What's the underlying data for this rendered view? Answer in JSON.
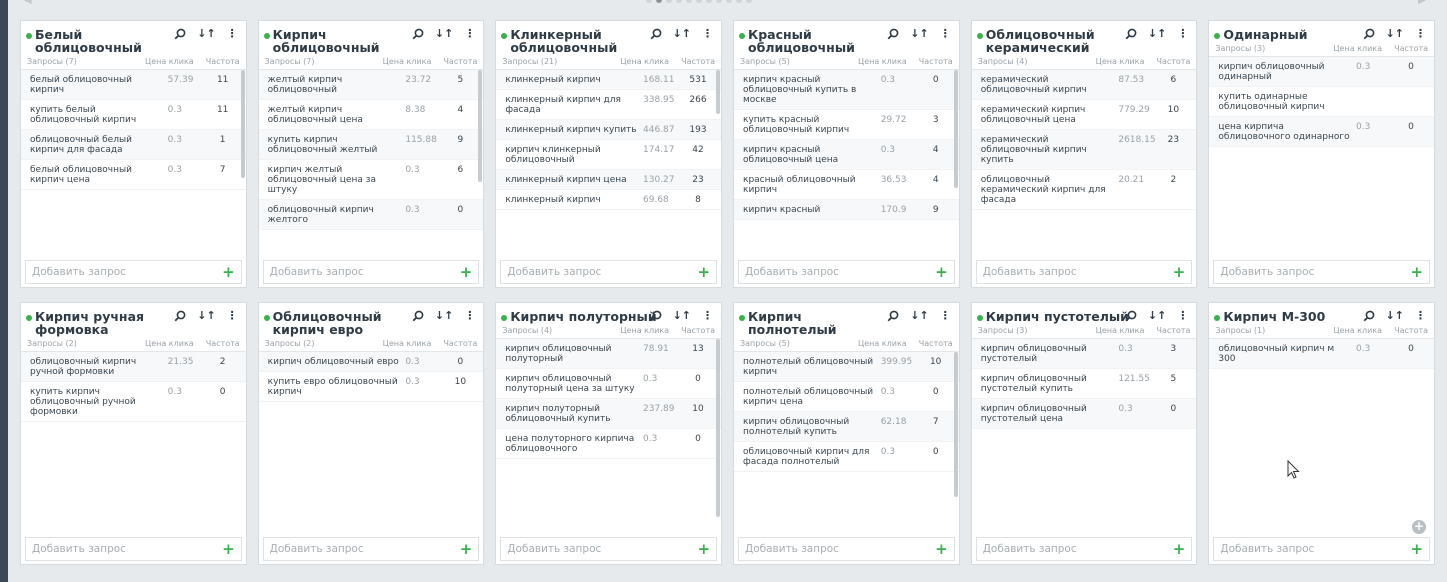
{
  "labels": {
    "col_price": "Цена клика",
    "col_freq": "Частота",
    "add_placeholder": "Добавить запрос"
  },
  "icons": {
    "search": "search-icon",
    "sort": "sort-icon",
    "more": "more-vertical-icon",
    "add": "plus-icon",
    "add_group": "circle-plus-icon",
    "cursor": "mouse-cursor-icon"
  },
  "colors": {
    "status": "#37b24d",
    "accent": "#37b24d"
  },
  "pager": {
    "total": 11,
    "active": 1
  },
  "cards": [
    {
      "title": "Белый облицовочный",
      "count": "Запросы (7)",
      "rows": [
        {
          "q": "белый облицовочный кирпич",
          "p": "57.39",
          "f": "11"
        },
        {
          "q": "купить белый облицовочный кирпич",
          "p": "0.3",
          "f": "11"
        },
        {
          "q": "облицовочный белый кирпич для фасада",
          "p": "0.3",
          "f": "1"
        },
        {
          "q": "белый облицовочный кирпич цена",
          "p": "0.3",
          "f": "7"
        }
      ]
    },
    {
      "title": "Кирпич облицовочный",
      "count": "Запросы (7)",
      "rows": [
        {
          "q": "желтый кирпич облицовочный",
          "p": "23.72",
          "f": "5"
        },
        {
          "q": "желтый кирпич облицовочный цена",
          "p": "8.38",
          "f": "4"
        },
        {
          "q": "купить кирпич облицовочный желтый",
          "p": "115.88",
          "f": "9"
        },
        {
          "q": "кирпич желтый облицовочный цена за штуку",
          "p": "0.3",
          "f": "6"
        },
        {
          "q": "облицовочный кирпич желтого",
          "p": "0.3",
          "f": "0"
        }
      ]
    },
    {
      "title": "Клинкерный облицовочный",
      "count": "Запросы (21)",
      "rows": [
        {
          "q": "клинкерный кирпич",
          "p": "168.11",
          "f": "531"
        },
        {
          "q": "клинкерный кирпич для фасада",
          "p": "338.95",
          "f": "266"
        },
        {
          "q": "клинкерный кирпич купить",
          "p": "446.87",
          "f": "193"
        },
        {
          "q": "кирпич клинкерный облицовочный",
          "p": "174.17",
          "f": "42"
        },
        {
          "q": "клинкерный кирпич цена",
          "p": "130.27",
          "f": "23"
        },
        {
          "q": "клинкерный кирпич",
          "p": "69.68",
          "f": "8"
        }
      ]
    },
    {
      "title": "Красный облицовочный",
      "count": "Запросы (5)",
      "rows": [
        {
          "q": "кирпич красный облицовочный купить в москве",
          "p": "0.3",
          "f": "0"
        },
        {
          "q": "купить красный облицовочный кирпич",
          "p": "29.72",
          "f": "3"
        },
        {
          "q": "кирпич красный облицовочный цена",
          "p": "0.3",
          "f": "4"
        },
        {
          "q": "красный облицовочный кирпич",
          "p": "36.53",
          "f": "4"
        },
        {
          "q": "кирпич красный",
          "p": "170.9",
          "f": "9"
        }
      ]
    },
    {
      "title": "Облицовочный керамический",
      "count": "Запросы (4)",
      "rows": [
        {
          "q": "керамический облицовочный кирпич",
          "p": "87.53",
          "f": "6"
        },
        {
          "q": "керамический кирпич облицовочный цена",
          "p": "779.29",
          "f": "10"
        },
        {
          "q": "керамический облицовочный кирпич купить",
          "p": "2618.15",
          "f": "23"
        },
        {
          "q": "облицовочный керамический кирпич для фасада",
          "p": "20.21",
          "f": "2"
        }
      ]
    },
    {
      "title": "Одинарный",
      "count": "Запросы (3)",
      "rows": [
        {
          "q": "кирпич облицовочный одинарный",
          "p": "0.3",
          "f": "0"
        },
        {
          "q": "купить одинарные облицовочный кирпич",
          "p": "",
          "f": ""
        },
        {
          "q": "цена кирпича облицовочного одинарного",
          "p": "0.3",
          "f": "0"
        }
      ]
    },
    {
      "title": "Кирпич ручная формовка",
      "count": "Запросы (2)",
      "rows": [
        {
          "q": "облицовочный кирпич ручной формовки",
          "p": "21.35",
          "f": "2"
        },
        {
          "q": "купить кирпич облицовочный ручной формовки",
          "p": "0.3",
          "f": "0"
        }
      ]
    },
    {
      "title": "Облицовочный кирпич евро",
      "count": "Запросы (2)",
      "rows": [
        {
          "q": "кирпич облицовочный евро",
          "p": "0.3",
          "f": "0"
        },
        {
          "q": "купить евро облицовочный кирпич",
          "p": "0.3",
          "f": "10"
        }
      ]
    },
    {
      "title": "Кирпич полуторный",
      "count": "Запросы (4)",
      "rows": [
        {
          "q": "кирпич облицовочный полуторный",
          "p": "78.91",
          "f": "13"
        },
        {
          "q": "кирпич облицовочный полуторный цена за штуку",
          "p": "0.3",
          "f": "0"
        },
        {
          "q": "кирпич полуторный облицовочный купить",
          "p": "237.89",
          "f": "10"
        },
        {
          "q": "цена полуторного кирпича облицовочного",
          "p": "0.3",
          "f": "0"
        }
      ]
    },
    {
      "title": "Кирпич полнотелый",
      "count": "Запросы (5)",
      "rows": [
        {
          "q": "полнотелый облицовочный кирпич",
          "p": "399.95",
          "f": "10"
        },
        {
          "q": "полнотелый облицовочный кирпич цена",
          "p": "0.3",
          "f": "0"
        },
        {
          "q": "кирпич облицовочный полнотелый купить",
          "p": "62.18",
          "f": "7"
        },
        {
          "q": "облицовочный кирпич для фасада полнотелый",
          "p": "0.3",
          "f": "0"
        }
      ]
    },
    {
      "title": "Кирпич пустотелый",
      "count": "Запросы (3)",
      "rows": [
        {
          "q": "кирпич облицовочный пустотелый",
          "p": "0.3",
          "f": "3"
        },
        {
          "q": "кирпич облицовочный пустотелый купить",
          "p": "121.55",
          "f": "5"
        },
        {
          "q": "кирпич облицовочный пустотелый цена",
          "p": "0.3",
          "f": "0"
        }
      ]
    },
    {
      "title": "Кирпич М-300",
      "count": "Запросы (1)",
      "rows": [
        {
          "q": "облицовочный кирпич м 300",
          "p": "0.3",
          "f": "0"
        }
      ]
    }
  ]
}
